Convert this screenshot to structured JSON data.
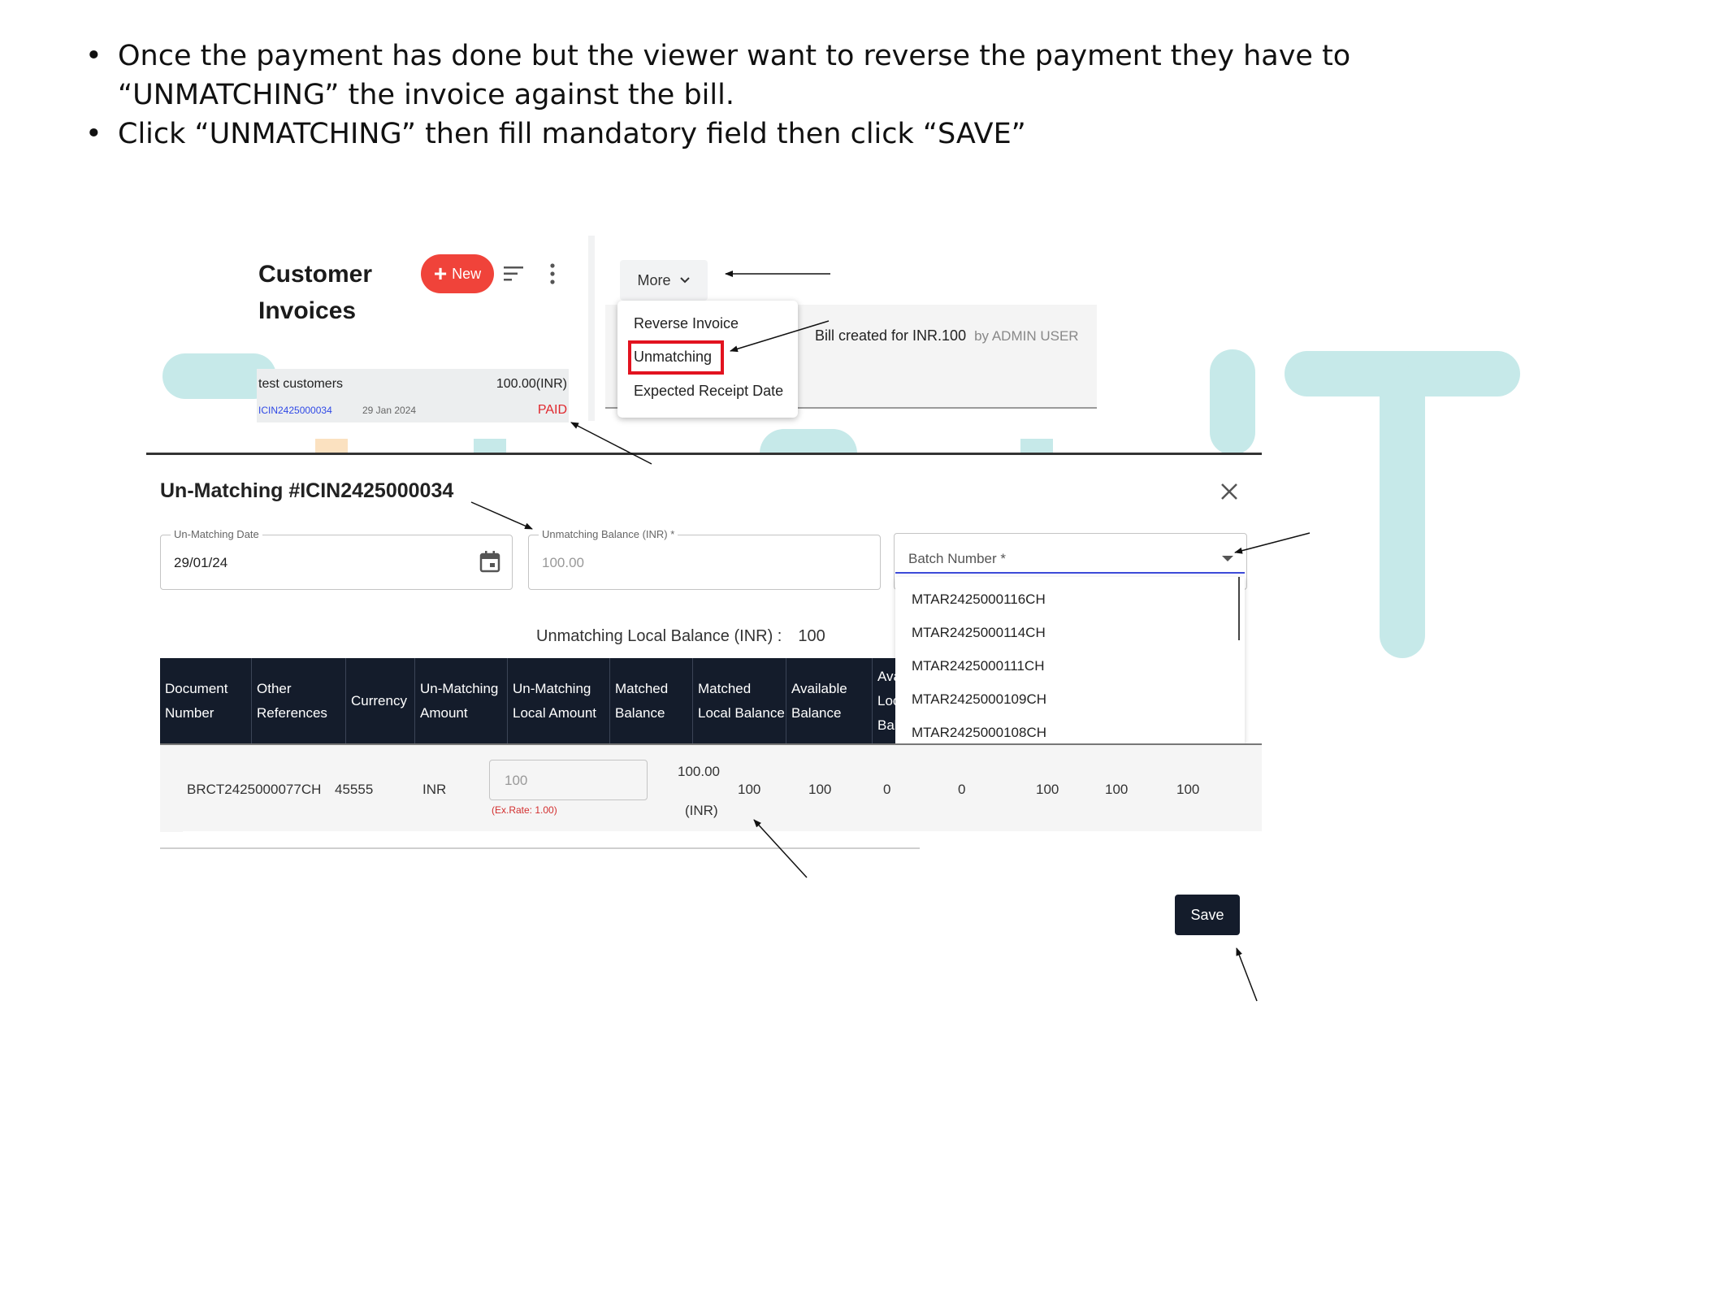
{
  "instructions": [
    "Once the payment has done but the viewer want to reverse the payment they have to “UNMATCHING” the invoice against the bill.",
    "Click “UNMATCHING” then fill mandatory field then click “SAVE”"
  ],
  "invoices": {
    "title_line1": "Customer",
    "title_line2": "Invoices",
    "new_label": "New",
    "item": {
      "customer": "test customers",
      "amount": "100.00(INR)",
      "doc_no": "ICIN2425000034",
      "date": "29 Jan 2024",
      "status": "PAID"
    }
  },
  "detail": {
    "more_label": "More",
    "menu": [
      "Reverse Invoice",
      "Unmatching",
      "Expected Receipt Date"
    ],
    "bill_note": "Bill created for INR.100",
    "bill_by": "by ADMIN USER"
  },
  "modal": {
    "title": "Un-Matching #ICIN2425000034",
    "date_label": "Un-Matching Date",
    "date_value": "29/01/24",
    "balance_label": "Unmatching Balance (INR) *",
    "balance_value": "100.00",
    "batch_placeholder": "Batch Number *",
    "batch_options": [
      "MTAR2425000116CH",
      "MTAR2425000114CH",
      "MTAR2425000111CH",
      "MTAR2425000109CH",
      "MTAR2425000108CH"
    ],
    "local_balance_label": "Unmatching Local Balance (INR) :",
    "local_balance_value": "100",
    "columns": [
      "Document Number",
      "Other References",
      "Currency",
      "Un-Matching Amount",
      "Un-Matching Local Amount",
      "Matched Balance",
      "Matched Local Balance",
      "Available Balance",
      "Available Local Balance"
    ],
    "row": {
      "doc": "BRCT2425000077CH",
      "ref": "45555",
      "currency": "INR",
      "amount_input": "100",
      "ex_rate": "(Ex.Rate: 1.00)",
      "local_amount": "100.00",
      "local_amount_unit": "(INR)",
      "values": [
        "100",
        "100",
        "0",
        "0",
        "100",
        "100",
        "100"
      ]
    },
    "save_label": "Save"
  },
  "colors": {
    "new_button": "#f0433a",
    "table_header": "#141c2b",
    "highlight": "#e2131f",
    "watermark": "#c6e9e9"
  }
}
